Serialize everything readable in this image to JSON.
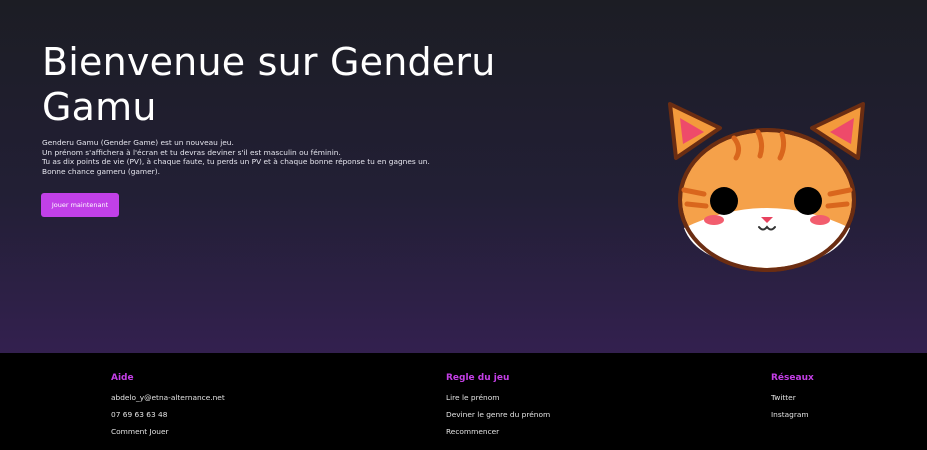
{
  "hero": {
    "title_line1": "Bienvenue sur Genderu",
    "title_line2": "Gamu",
    "description": [
      "Genderu Gamu (Gender Game) est un nouveau jeu.",
      "Un prénom s'affichera à l'écran et tu devras deviner s'il est masculin ou féminin.",
      "Tu as dix points de vie (PV), à chaque faute, tu perds un PV et à chaque bonne réponse tu en gagnes un.",
      "Bonne chance gameru (gamer)."
    ],
    "play_button": "Jouer maintenant",
    "mascot_icon": "cat-mascot-icon"
  },
  "footer": {
    "help": {
      "title": "Aide",
      "items": [
        "abdelo_y@etna-alternance.net",
        "07 69 63 63 48",
        "Comment Jouer"
      ]
    },
    "rules": {
      "title": "Regle du jeu",
      "items": [
        "Lire le prénom",
        "Deviner le genre du prénom",
        "Recommencer"
      ]
    },
    "social": {
      "title": "Réseaux",
      "items": [
        "Twitter",
        "Instagram"
      ]
    }
  },
  "colors": {
    "accent": "#c140e8",
    "hero_top": "#1c1d24",
    "hero_bottom": "#33204f",
    "footer_bg": "#000000"
  }
}
